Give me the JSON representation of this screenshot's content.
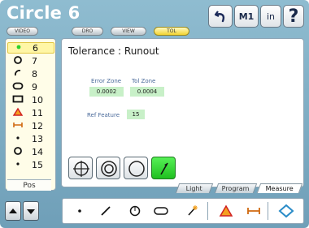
{
  "app": {
    "title": "Circle 6"
  },
  "header": {
    "modes": [
      "VIDEO",
      "DRO",
      "VIEW",
      "TOL"
    ],
    "active_mode": "TOL",
    "m1_label": "M1",
    "units_label": "in",
    "help_label": "?"
  },
  "features": [
    {
      "icon": "point-icon",
      "label": "6",
      "selected": true
    },
    {
      "icon": "circle-icon",
      "label": "7"
    },
    {
      "icon": "arc-icon",
      "label": "8"
    },
    {
      "icon": "slot-icon",
      "label": "9"
    },
    {
      "icon": "rectangle-icon",
      "label": "10"
    },
    {
      "icon": "angle-icon",
      "label": "11"
    },
    {
      "icon": "distance-icon",
      "label": "12"
    },
    {
      "icon": "point-icon",
      "label": "13"
    },
    {
      "icon": "circle-icon",
      "label": "14"
    },
    {
      "icon": "point-icon",
      "label": "15"
    }
  ],
  "pos_tab": "Pos",
  "tolerance": {
    "title": "Tolerance : Runout",
    "error_zone_label": "Error Zone",
    "error_zone_value": "0.0002",
    "tol_zone_label": "Tol Zone",
    "tol_zone_value": "0.0004",
    "ref_feature_label": "Ref Feature",
    "ref_feature_value": "15"
  },
  "tol_types": [
    {
      "icon": "position-icon"
    },
    {
      "icon": "concentricity-icon"
    },
    {
      "icon": "circularity-icon"
    },
    {
      "icon": "runout-icon",
      "active": true
    }
  ],
  "tabs": [
    {
      "label": "Light"
    },
    {
      "label": "Program"
    },
    {
      "label": "Measure",
      "active": true
    }
  ],
  "measure_tools": [
    "point-icon",
    "line-icon",
    "circle-icon",
    "slot-icon",
    "blob-icon",
    "angle-icon",
    "distance-icon",
    "skew-icon"
  ],
  "colors": {
    "frame": "#7aa8c0",
    "active_green": "#2ad02a",
    "tol_yellow": "#f2d330",
    "value_bg": "#c8f0c8"
  }
}
